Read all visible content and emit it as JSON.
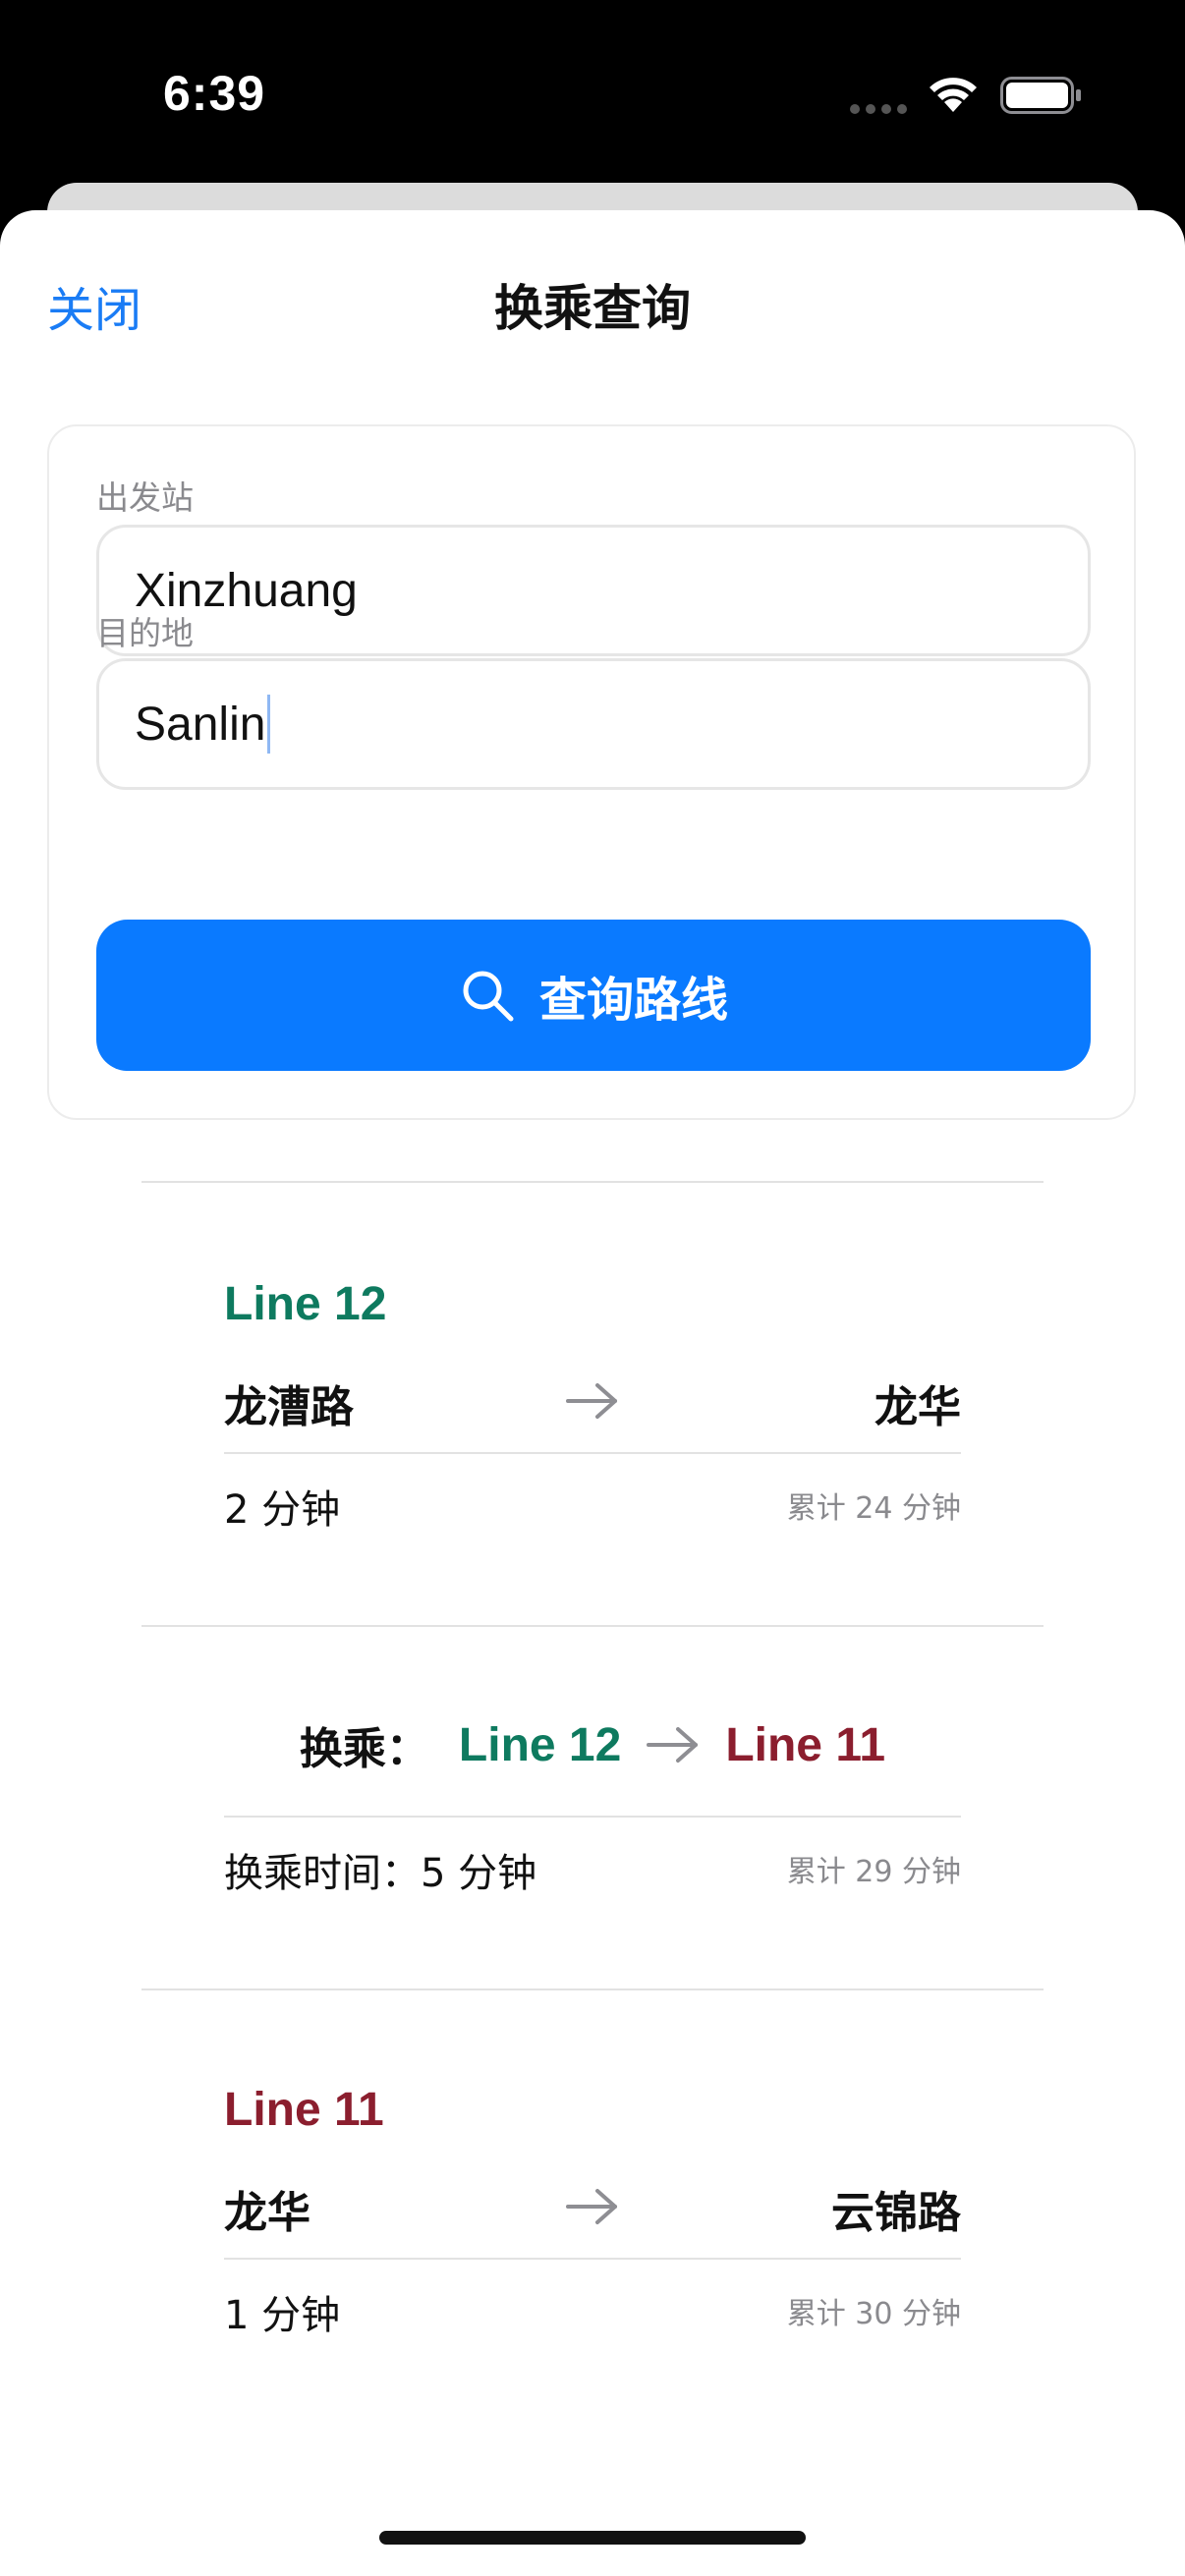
{
  "status_bar": {
    "time": "6:39"
  },
  "nav": {
    "close_label": "关闭",
    "title": "换乘查询"
  },
  "search": {
    "origin_label": "出发站",
    "origin_value": "Xinzhuang",
    "destination_label": "目的地",
    "destination_value": "Sanlin",
    "button_label": "查询路线"
  },
  "colors": {
    "accent": "#0A7AFF",
    "line12": "#0E7A5F",
    "line11": "#8B1E2E"
  },
  "route": {
    "segments": [
      {
        "line": "Line 12",
        "from": "龙漕路",
        "to": "龙华",
        "duration": "2 分钟",
        "cumulative": "累计 24 分钟"
      },
      {
        "line": "Line 11",
        "from": "龙华",
        "to": "云锦路",
        "duration": "1 分钟",
        "cumulative": "累计 30 分钟"
      }
    ],
    "transfer": {
      "label": "换乘：",
      "from_line": "Line 12",
      "to_line": "Line 11",
      "time_text": "换乘时间：5 分钟",
      "cumulative": "累计 29 分钟"
    }
  }
}
